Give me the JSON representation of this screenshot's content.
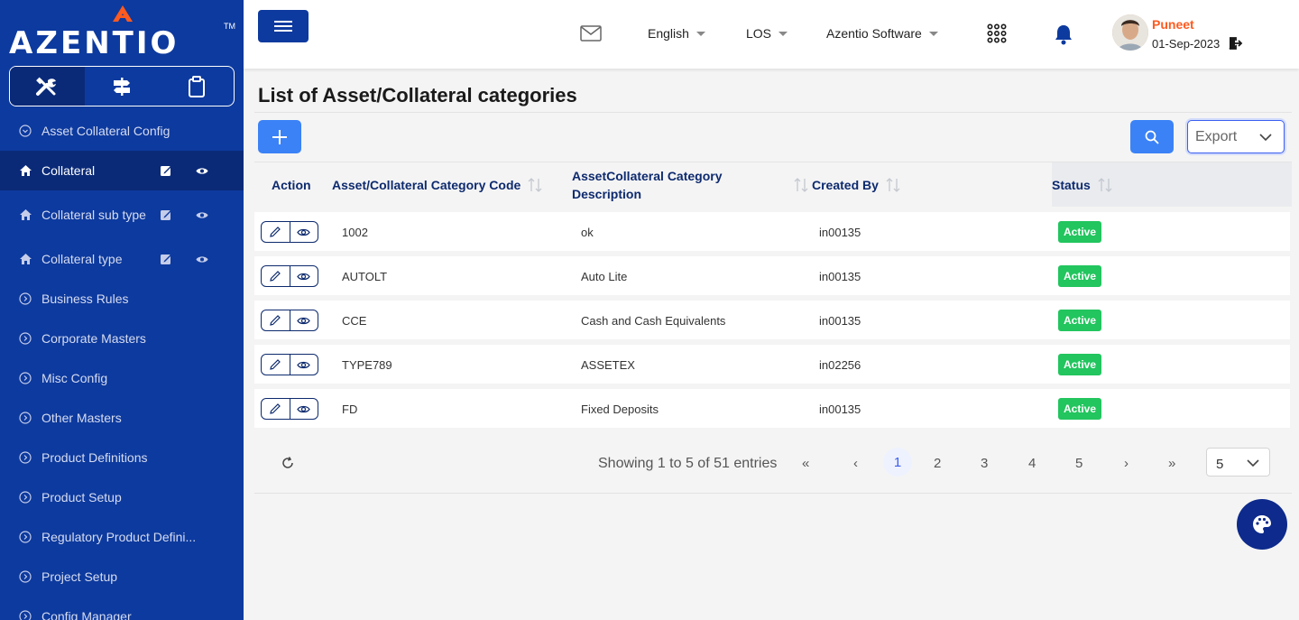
{
  "brand": {
    "name": "AZENTIO",
    "tm": "TM"
  },
  "sidebar": {
    "tabs": [
      {
        "icon": "tools-icon"
      },
      {
        "icon": "signpost-icon"
      },
      {
        "icon": "clipboard-icon"
      }
    ],
    "items": [
      {
        "label": "Asset Collateral Config"
      },
      {
        "label": "Collateral"
      },
      {
        "label": "Collateral sub type"
      },
      {
        "label": "Collateral type"
      },
      {
        "label": "Business Rules"
      },
      {
        "label": "Corporate Masters"
      },
      {
        "label": "Misc Config"
      },
      {
        "label": "Other Masters"
      },
      {
        "label": "Product Definitions"
      },
      {
        "label": "Product Setup"
      },
      {
        "label": "Regulatory Product Defini..."
      },
      {
        "label": "Project Setup"
      },
      {
        "label": "Config Manager"
      }
    ]
  },
  "header": {
    "language": "English",
    "module": "LOS",
    "company": "Azentio Software",
    "user": {
      "name": "Puneet",
      "date": "01-Sep-2023"
    }
  },
  "page": {
    "title": "List of Asset/Collateral categories",
    "export_label": "Export"
  },
  "table": {
    "columns": {
      "action": "Action",
      "code": "Asset/Collateral Category Code",
      "description": "AssetCollateral Category Description",
      "created_by": "Created By",
      "status": "Status"
    },
    "rows": [
      {
        "code": "1002",
        "description": "ok",
        "created_by": "in00135",
        "status": "Active"
      },
      {
        "code": "AUTOLT",
        "description": "Auto Lite",
        "created_by": "in00135",
        "status": "Active"
      },
      {
        "code": "CCE",
        "description": "Cash and Cash Equivalents",
        "created_by": "in00135",
        "status": "Active"
      },
      {
        "code": "TYPE789",
        "description": "ASSETEX",
        "created_by": "in02256",
        "status": "Active"
      },
      {
        "code": "FD",
        "description": "Fixed Deposits",
        "created_by": "in00135",
        "status": "Active"
      }
    ]
  },
  "pagination": {
    "showing": "Showing 1 to 5 of 51 entries",
    "first": "«",
    "prev": "‹",
    "next": "›",
    "last": "»",
    "pages": [
      "1",
      "2",
      "3",
      "4",
      "5"
    ],
    "current_page": "1",
    "per_page": "5"
  },
  "colors": {
    "sidebar": "#0d3a9e",
    "primary_button": "#3b82f6",
    "status_active": "#22c55e",
    "user_name": "#ff5a1f"
  }
}
